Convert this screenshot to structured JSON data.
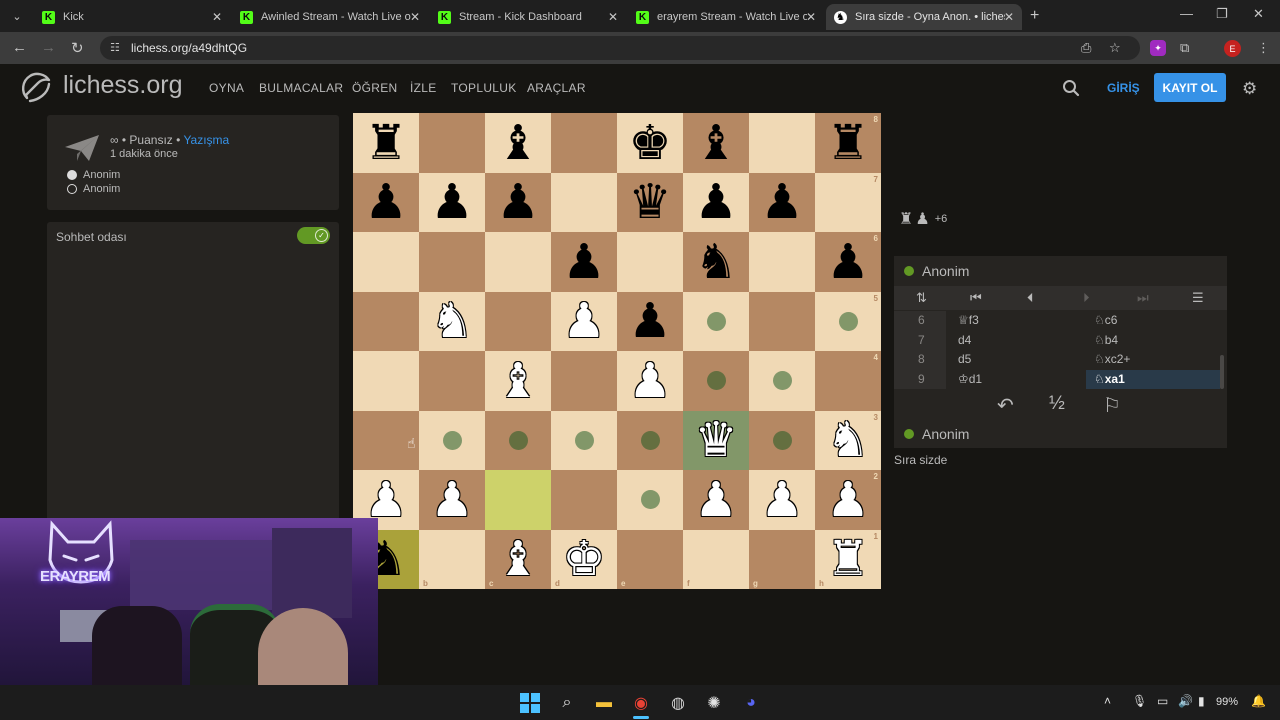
{
  "browser": {
    "tabs": [
      {
        "title": "Kick",
        "favicon": "kick-icon",
        "active": false
      },
      {
        "title": "Awinled Stream - Watch Live on",
        "favicon": "kick-icon",
        "active": false
      },
      {
        "title": "Stream - Kick Dashboard",
        "favicon": "kick-icon",
        "active": false
      },
      {
        "title": "erayrem Stream - Watch Live on",
        "favicon": "kick-icon",
        "active": false
      },
      {
        "title": "Sıra sizde - Oyna Anon. • liches",
        "favicon": "lichess-icon",
        "active": true
      }
    ],
    "url": "lichess.org/a49dhtQG",
    "profile_initial": "E"
  },
  "header": {
    "logo_text": "lichess.org",
    "nav": [
      "OYNA",
      "BULMACALAR",
      "ÖĞREN",
      "İZLE",
      "TOPLULUK",
      "ARAÇLAR"
    ],
    "login": "GİRİŞ",
    "signup": "KAYIT OL"
  },
  "game_info": {
    "setup_prefix": "∞ • Puansız • ",
    "setup_link": "Yazışma",
    "time_ago": "1 dakika önce",
    "white_player": "Anonim",
    "black_player": "Anonim"
  },
  "chat": {
    "title": "Sohbet odası",
    "enabled": true
  },
  "board": {
    "ranks": [
      "8",
      "7",
      "6",
      "5",
      "4",
      "3",
      "2",
      "1"
    ],
    "files": [
      "a",
      "b",
      "c",
      "d",
      "e",
      "f",
      "g",
      "h"
    ],
    "position": [
      [
        "r",
        "",
        "b",
        "",
        "k",
        "b",
        "",
        "r"
      ],
      [
        "p",
        "p",
        "p",
        "",
        "q",
        "p",
        "p",
        ""
      ],
      [
        "",
        "",
        "",
        "p",
        "",
        "n",
        "",
        "p"
      ],
      [
        "",
        "N",
        "",
        "P",
        "p",
        "",
        "",
        ""
      ],
      [
        "",
        "",
        "B",
        "",
        "P",
        "",
        "",
        ""
      ],
      [
        "",
        "",
        "",
        "",
        "",
        "Q",
        "",
        "N"
      ],
      [
        "P",
        "P",
        "",
        "",
        "",
        "P",
        "P",
        "P"
      ],
      [
        "n",
        "",
        "B",
        "K",
        "",
        "",
        "",
        "R"
      ]
    ],
    "last_move": [
      "c2",
      "a1"
    ],
    "selected": "f3",
    "legal_destinations": [
      "f5",
      "h5",
      "f4",
      "g4",
      "b3",
      "c3",
      "d3",
      "e3",
      "g3",
      "e2"
    ]
  },
  "material": {
    "pieces": [
      "rook-icon",
      "pawn-icon"
    ],
    "advantage": "+6"
  },
  "moves_panel": {
    "top_player": "Anonim",
    "bottom_player": "Anonim",
    "moves": [
      {
        "num": "6",
        "white": "♕f3",
        "black": "♘c6"
      },
      {
        "num": "7",
        "white": "d4",
        "black": "♘b4"
      },
      {
        "num": "8",
        "white": "d5",
        "black": "♘xc2+"
      },
      {
        "num": "9",
        "white": "♔d1",
        "black": "♘xa1"
      }
    ],
    "active_move": "9.black",
    "draw_label": "½"
  },
  "status": {
    "turn_text": "Sıra sizde"
  },
  "webcam": {
    "logo_text": "ERAYREM"
  },
  "taskbar": {
    "battery": "99%"
  }
}
